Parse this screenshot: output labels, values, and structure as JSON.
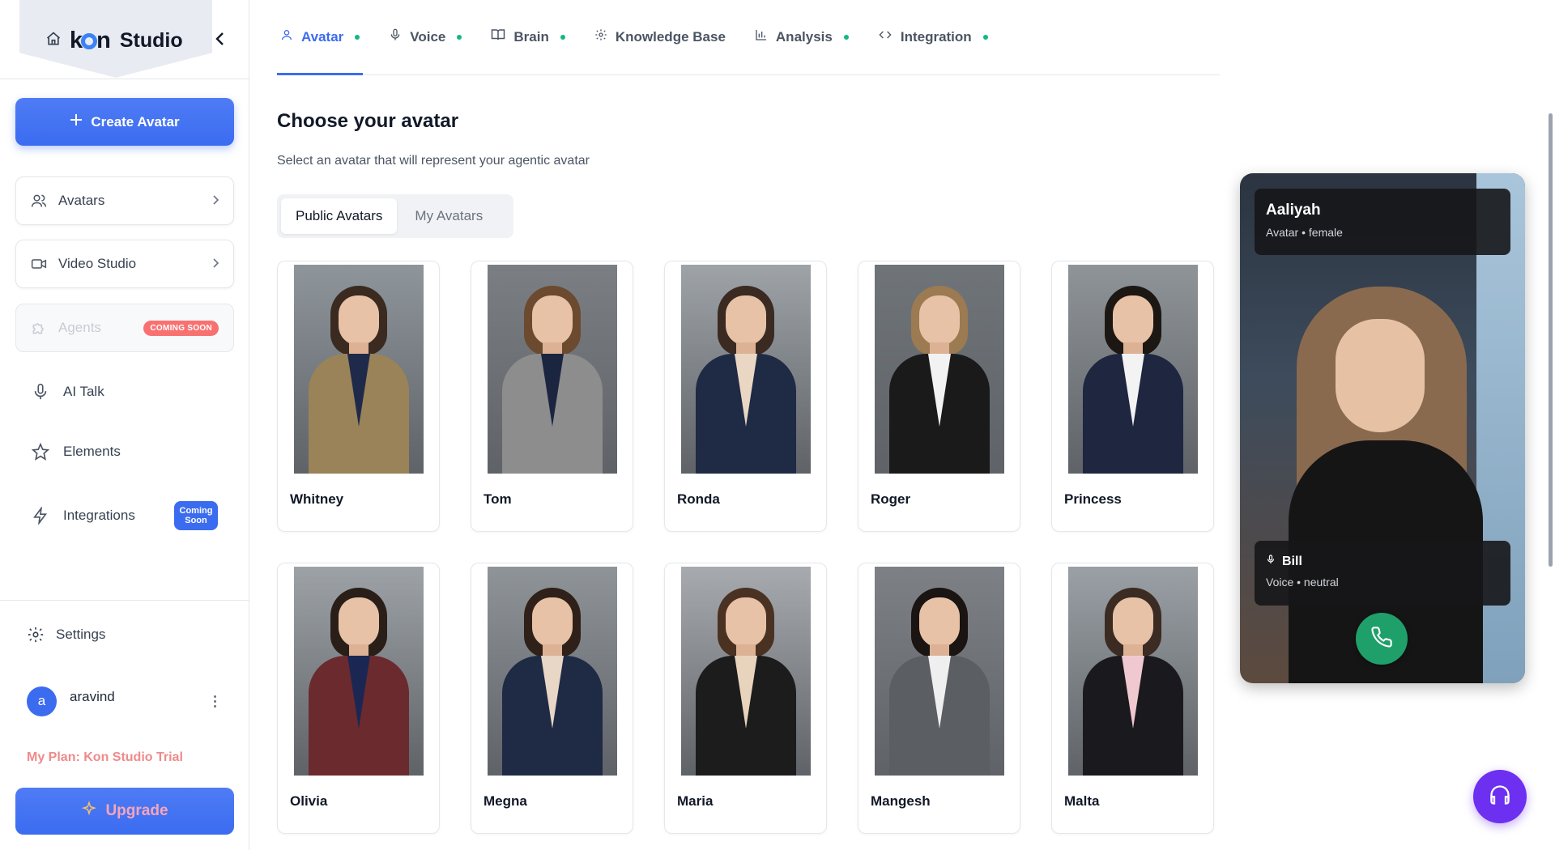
{
  "brand": {
    "name": "kon",
    "studio": "Studio"
  },
  "sidebar": {
    "create_label": "Create Avatar",
    "items": [
      {
        "label": "Avatars",
        "icon": "users-icon"
      },
      {
        "label": "Video Studio",
        "icon": "video-icon"
      },
      {
        "label": "Agents",
        "icon": "puzzle-icon",
        "badge": "COMING SOON",
        "disabled": true
      },
      {
        "label": "AI Talk",
        "icon": "mic-icon"
      },
      {
        "label": "Elements",
        "icon": "star-icon"
      },
      {
        "label": "Integrations",
        "icon": "zap-icon",
        "badge_line1": "Coming",
        "badge_line2": "Soon"
      }
    ],
    "settings_label": "Settings",
    "user": {
      "initial": "a",
      "name": "aravind"
    },
    "plan_label": "My Plan: Kon Studio Trial",
    "upgrade_label": "Upgrade"
  },
  "tabs": [
    {
      "label": "Avatar",
      "active": true,
      "dot": true
    },
    {
      "label": "Voice",
      "dot": true
    },
    {
      "label": "Brain",
      "dot": true
    },
    {
      "label": "Knowledge Base",
      "dot": false
    },
    {
      "label": "Analysis",
      "dot": true
    },
    {
      "label": "Integration",
      "dot": true
    }
  ],
  "main": {
    "title": "Choose your avatar",
    "subtitle": "Select an avatar that will represent your agentic avatar",
    "segments": [
      "Public Avatars",
      "My Avatars"
    ]
  },
  "avatars": [
    {
      "name": "Whitney",
      "bg": "#8e959b",
      "hair": "#3a2a20",
      "suit": "#9a8358",
      "shirt": "#1f2a4a"
    },
    {
      "name": "Tom",
      "bg": "#7b7f84",
      "hair": "#6b4a2f",
      "suit": "#8d8d8d",
      "shirt": "#1c2540"
    },
    {
      "name": "Ronda",
      "bg": "#9ea3a8",
      "hair": "#3b2a22",
      "suit": "#1f2a44",
      "shirt": "#e9d7c4"
    },
    {
      "name": "Roger",
      "bg": "#6f7479",
      "hair": "#9c7a52",
      "suit": "#1a1a1a",
      "shirt": "#f2f2f2"
    },
    {
      "name": "Princess",
      "bg": "#8f9498",
      "hair": "#1d1714",
      "suit": "#1e2640",
      "shirt": "#f3f3f3"
    },
    {
      "name": "Olivia",
      "bg": "#9da2a7",
      "hair": "#2a1e18",
      "suit": "#6b2a2e",
      "shirt": "#1b2752"
    },
    {
      "name": "Megna",
      "bg": "#8f9499",
      "hair": "#2f2119",
      "suit": "#1f2a44",
      "shirt": "#e8d6c6"
    },
    {
      "name": "Maria",
      "bg": "#a7abaf",
      "hair": "#4a3223",
      "suit": "#1c1c1c",
      "shirt": "#e8d3bd"
    },
    {
      "name": "Mangesh",
      "bg": "#7d8186",
      "hair": "#1a1412",
      "suit": "#5b5e63",
      "shirt": "#efefef"
    },
    {
      "name": "Malta",
      "bg": "#9aa0a5",
      "hair": "#3b2b22",
      "suit": "#1a1a1e",
      "shirt": "#f0c8cf"
    }
  ],
  "preview": {
    "avatar_name": "Aaliyah",
    "avatar_meta": "Avatar • female",
    "voice_name": "Bill",
    "voice_meta": "Voice • neutral"
  },
  "colors": {
    "accent": "#3b6cf0",
    "status_dot": "#10b981",
    "call": "#1fa06a",
    "fab": "#6d2ff0"
  }
}
